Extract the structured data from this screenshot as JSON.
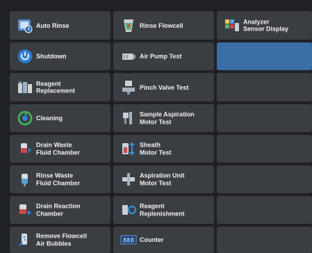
{
  "menu": {
    "col1": [
      {
        "label": "Auto Rinse",
        "icon": "auto-rinse-icon"
      },
      {
        "label": "Shutdown",
        "icon": "power-icon"
      },
      {
        "label": "Reagent\nReplacement",
        "icon": "reagent-bottles-icon"
      },
      {
        "label": "Cleaning",
        "icon": "recycle-icon"
      },
      {
        "label": "Drain Waste\nFluid Chamber",
        "icon": "drain-chamber-icon"
      },
      {
        "label": "Rinse Waste\nFluid Chamber",
        "icon": "rinse-chamber-icon"
      },
      {
        "label": "Drain Reaction\nChamber",
        "icon": "drain-reaction-icon"
      },
      {
        "label": "Remove Flowcell\nAir Bubbles",
        "icon": "air-bubbles-icon"
      }
    ],
    "col2": [
      {
        "label": "Rinse Flowcell",
        "icon": "flowcell-icon"
      },
      {
        "label": "Air Pump Test",
        "icon": "air-pump-icon"
      },
      {
        "label": "Pinch Valve Test",
        "icon": "pinch-valve-icon"
      },
      {
        "label": "Sample Aspiration\nMotor Test",
        "icon": "aspiration-motor-icon"
      },
      {
        "label": "Sheath\nMotor Test",
        "icon": "sheath-motor-icon"
      },
      {
        "label": "Aspiration Unit\nMotor Test",
        "icon": "aspiration-unit-icon"
      },
      {
        "label": "Reagent\nReplenishment",
        "icon": "replenish-icon"
      },
      {
        "label": "Counter",
        "icon": "counter-icon"
      }
    ],
    "col3": [
      {
        "label": "Analyzer\nSensor Display",
        "icon": "sensor-display-icon"
      }
    ]
  },
  "colors": {
    "background": "#1f2124",
    "tile": "#3a3d42",
    "selected": "#3a6ea5"
  }
}
